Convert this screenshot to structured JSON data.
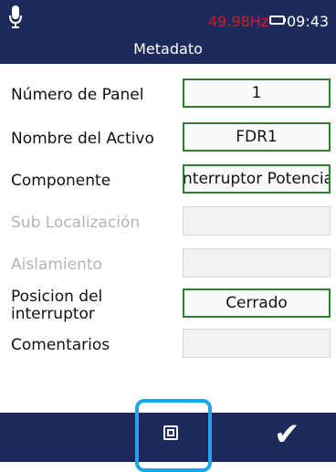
{
  "status_bar": {
    "frequency": "49.98Hz",
    "time": "09:43"
  },
  "header": {
    "title": "Metadato"
  },
  "form": {
    "fields": [
      {
        "label": "Número de Panel",
        "value": "1",
        "enabled": true
      },
      {
        "label": "Nombre del Activo",
        "value": "FDR1",
        "enabled": true
      },
      {
        "label": "Componente",
        "value": "nterruptor Potencia",
        "enabled": true
      },
      {
        "label": "Sub Localización",
        "value": "",
        "enabled": false
      },
      {
        "label": "Aislamiento",
        "value": "",
        "enabled": false
      },
      {
        "label_line1": "Posicion del",
        "label_line2": "interruptor",
        "value": "Cerrado",
        "enabled": true
      },
      {
        "label": "Comentarios",
        "value": "",
        "enabled": true
      }
    ]
  },
  "icons": {
    "microphone": "microphone-icon",
    "battery": "battery-icon",
    "save": "save-icon",
    "confirm": "checkmark-icon"
  },
  "colors": {
    "header_bg": "#1d2a5c",
    "frequency_text": "#d41c1c",
    "field_border_active": "#2e7d32",
    "focus_ring": "#1aa6e8"
  }
}
